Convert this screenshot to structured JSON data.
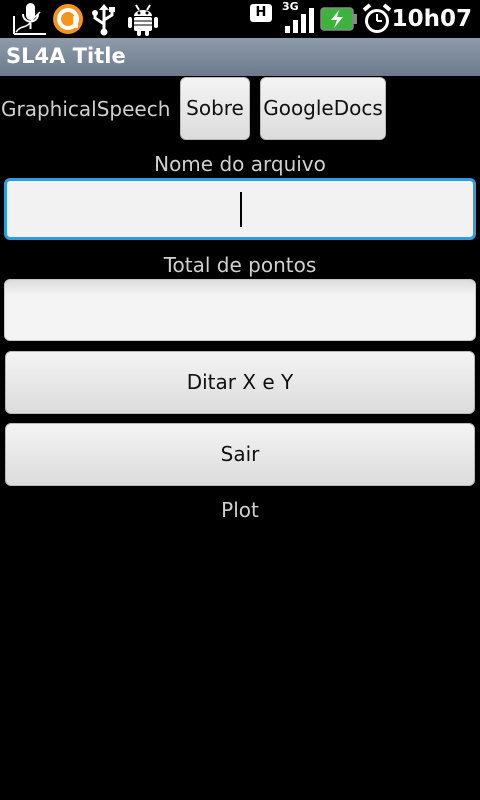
{
  "status_bar": {
    "time": "10h07",
    "network_type": "3G",
    "hspa_badge": "H",
    "icons": [
      "voice-search-icon",
      "app-notification-icon",
      "usb-icon",
      "android-debug-icon",
      "signal-icon",
      "battery-charging-icon",
      "alarm-clock-icon"
    ]
  },
  "title_bar": {
    "title": "SL4A Title"
  },
  "main": {
    "app_label": "GraphicalSpeech",
    "about_button": "Sobre",
    "googledocs_button": "GoogleDocs",
    "filename_label": "Nome do arquivo",
    "filename_value": "",
    "total_label": "Total de pontos",
    "total_value": "",
    "dictate_button": "Ditar X e Y",
    "exit_button": "Sair",
    "plot_label": "Plot"
  },
  "colors": {
    "background": "#000000",
    "titlebar": "#7b8899",
    "focus_border": "#2f9be3",
    "battery_green": "#3cb43c"
  }
}
